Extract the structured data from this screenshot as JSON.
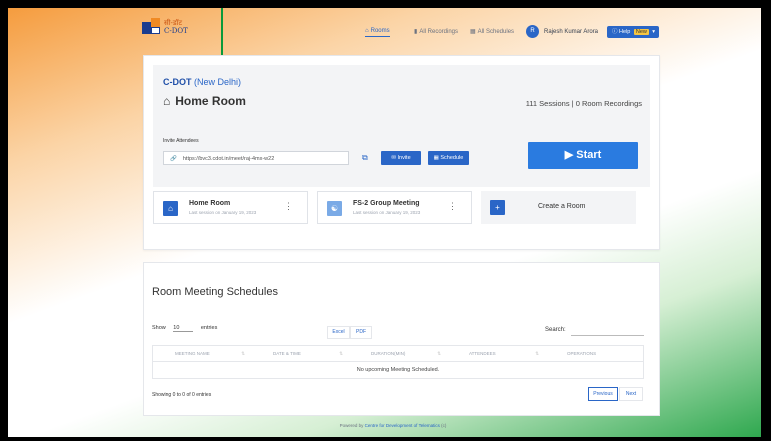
{
  "brand": {
    "line1": "सी-डॉट",
    "line2": "C-DOT"
  },
  "nav": {
    "rooms": "Rooms",
    "recordings": "All Recordings",
    "schedules": "All Schedules",
    "user_initial": "R",
    "user_name": "Rajesh Kumar Arora",
    "help": "Help",
    "help_badge": "New",
    "rooms_icon": "home-icon",
    "recordings_icon": "video-icon",
    "schedules_icon": "calendar-icon"
  },
  "home": {
    "org": "C-DOT",
    "city": "(New Delhi)",
    "title": "Home Room",
    "stats": "111 Sessions | 0 Room Recordings",
    "invite_label": "Invite Attendees",
    "invite_link": "https://bvc3.cdot.in/meet/raj-4mx-w22",
    "invite_button": "Invite",
    "schedule_button": "Schedule",
    "start_button": "Start"
  },
  "rooms": [
    {
      "title": "Home Room",
      "sub": "Last session on January 19, 2023"
    },
    {
      "title": "FS-2 Group Meeting",
      "sub": "Last session on January 19, 2023"
    }
  ],
  "create_room": "Create a Room",
  "schedules": {
    "title": "Room Meeting Schedules",
    "show": "Show",
    "entries": "entries",
    "show_value": "10",
    "excel": "Excel",
    "pdf": "PDF",
    "search": "Search:",
    "columns": [
      "MEETING NAME",
      "DATE & TIME",
      "DURATION(MIN)",
      "ATTENDEES",
      "OPERATIONS"
    ],
    "empty": "No upcoming Meeting Scheduled.",
    "info": "Showing 0 to 0 of 0 entries",
    "previous": "Previous",
    "next": "Next"
  },
  "footer": {
    "prefix": "Powered by",
    "org": "Centre for Development of Telematics",
    "suffix": "(c)"
  },
  "colors": {
    "primary": "#2a66c7",
    "start": "#2a7be0",
    "saffron": "#f59c3e",
    "green": "#2fa84f",
    "arrow": "#0a9a3a"
  }
}
